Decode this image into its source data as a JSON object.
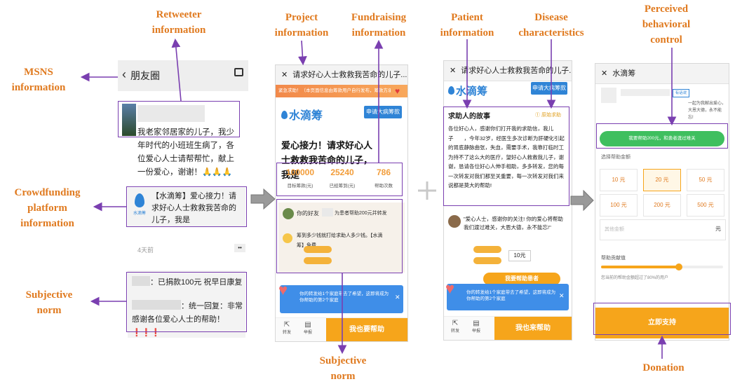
{
  "labels": {
    "retweeter": "Retweeter\ninformation",
    "msns": "MSNS\ninformation",
    "crowdfunding": "Crowdfunding\nplatform\ninformation",
    "subjective_left": "Subjective\nnorm",
    "project": "Project\ninformation",
    "fundraising": "Fundraising\ninformation",
    "subjective_bottom": "Subjective\nnorm",
    "patient": "Patient\ninformation",
    "disease": "Disease\ncharacteristics",
    "perceived": "Perceived\nbehavioral\ncontrol",
    "donation": "Donation"
  },
  "screen1": {
    "title": "朋友圈",
    "post_text": "我老家邻居家的儿子，我少年时代的小班班生病了，各位爱心人士请帮帮忙，献上一份爱心，谢谢！🙏🙏🙏",
    "share_text": "【水滴筹】爱心接力！请求好心人士救救我苦命的儿子，我是",
    "logo_text": "水滴筹",
    "time": "4天前",
    "comment1": "：已捐款100元 祝早日康复",
    "comment2": "：统一回复：非常感谢各位爱心人士的帮助！❗❗❗"
  },
  "screen2": {
    "title": "请求好心人士救救我苦命的儿子...",
    "banner": "紧急求助！（本页面信息由筹款用户自行发布，筹款方承担信息真实性）",
    "logo": "水滴筹",
    "button": "申请大病筹款",
    "headline": "爱心接力！请求好心人士救救我苦命的儿子，我是",
    "stats": [
      {
        "value": "100000",
        "label": "目标筹款(元)"
      },
      {
        "value": "25240",
        "label": "已经筹到(元)"
      },
      {
        "value": "786",
        "label": "帮助次数"
      }
    ],
    "friend_text": "你的好友",
    "friend_action": "为患者帮助200元并转发",
    "share_title": "筹到多少钱就打给求助人多少钱。【水滴",
    "share_sub": "筹】免费",
    "notice": "你的转发给1个家庭带去了希望，这即将成为你帮助的第2个家庭",
    "bottom_btn": "我也要帮助",
    "share_label": "转发",
    "report_label": "举报"
  },
  "screen3": {
    "title": "请求好心人士救救我苦命的儿子...",
    "logo": "水滴筹",
    "button": "申请大病筹款",
    "story_title": "求助人的故事",
    "story_tag": "① 原始求助",
    "story": "各位好心人，感谢你们打开我的求助信，我儿子　　，今年32岁，经医生多次诊断为肝硬化引起的胃底静脉曲张，失血，需要手术，我靠打临时工为持不了这么大的医疗，望好心人救救我儿子，谢谢，恳请各位好心人伸手相助，多多转发，您的每一次转发对我们都至关重要，每一次转发对我们来说都是莫大的帮助!",
    "comment": "\"爱心人士，感谢你的关注! 你的爱心将帮助我们渡过难关，大恩大德，永不能忘!\"",
    "amount": "10元",
    "help_btn": "我要帮助患者",
    "notice": "你的转发给1个家庭带去了希望，这即将成为你帮助的第2个家庭",
    "bottom_btn": "我也来帮助",
    "share_label": "转发",
    "report_label": "举报"
  },
  "screen4": {
    "title": "水滴筹",
    "note": "一起为我献出爱心，大恩大德，永不能忘!",
    "badge": "有话说",
    "green_btn": "我要帮助200元，和患者渡过难关",
    "select_label": "选择帮助金额",
    "amounts": [
      "10 元",
      "20 元",
      "50 元",
      "100 元",
      "200 元",
      "500 元"
    ],
    "custom_placeholder": "其他金额",
    "custom_unit": "元",
    "fee_label": "帮助贡献值",
    "fee_note": "您当前的帮助金额超过了80%的用户",
    "bottom_btn": "立即支持"
  },
  "colors": {
    "accent": "#e07a1f",
    "highlight": "#7a3fb0",
    "orange": "#f6a51b",
    "blue": "#2f84d6",
    "green": "#3fbf5f"
  }
}
